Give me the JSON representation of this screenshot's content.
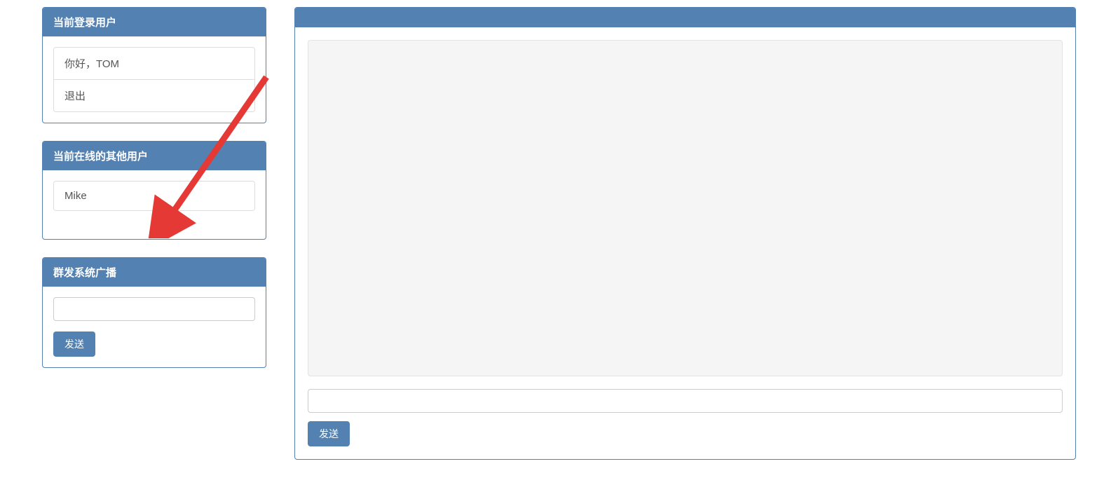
{
  "sidebar": {
    "currentUser": {
      "title": "当前登录用户",
      "greeting": "你好，TOM",
      "logout": "退出"
    },
    "onlineUsers": {
      "title": "当前在线的其他用户",
      "users": [
        "Mike"
      ]
    },
    "broadcast": {
      "title": "群发系统广播",
      "input_value": "",
      "send_label": "发送"
    }
  },
  "chat": {
    "input_value": "",
    "send_label": "发送"
  },
  "colors": {
    "panel_blue": "#5281b2"
  }
}
